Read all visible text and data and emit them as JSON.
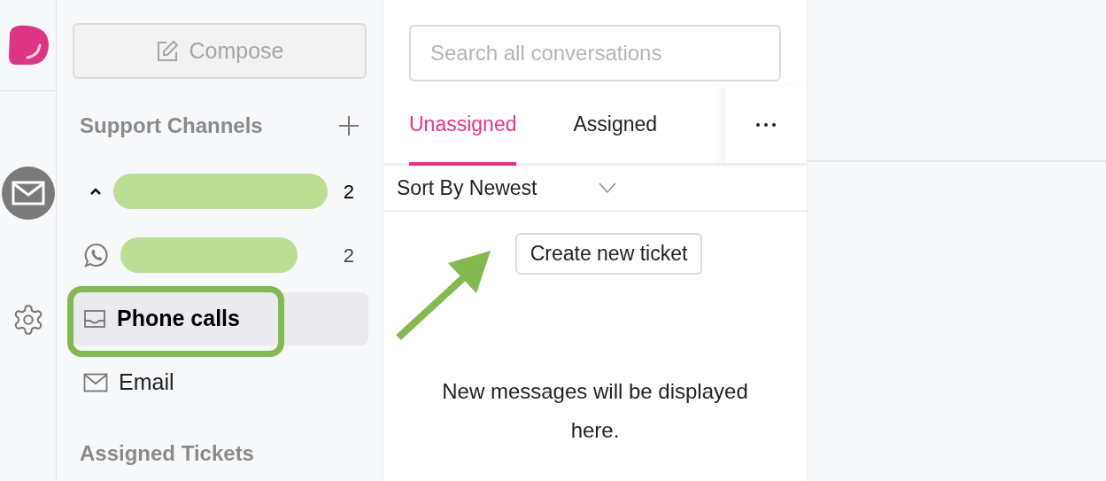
{
  "compose": {
    "label": "Compose",
    "disabled": true
  },
  "support_channels": {
    "title": "Support Channels",
    "items": [
      {
        "kind": "group",
        "count": "2",
        "selected": false
      },
      {
        "kind": "whatsapp",
        "count": "2",
        "selected": false
      },
      {
        "kind": "inbox",
        "label": "Phone calls",
        "selected": true
      },
      {
        "kind": "mail",
        "label": "Email",
        "selected": false
      }
    ]
  },
  "assigned_tickets": {
    "title": "Assigned Tickets"
  },
  "search": {
    "placeholder": "Search all conversations"
  },
  "tabs": [
    {
      "label": "Unassigned",
      "selected": true
    },
    {
      "label": "Assigned",
      "selected": false
    }
  ],
  "sort": {
    "label": "Sort By Newest"
  },
  "create_button": {
    "label": "Create new ticket"
  },
  "empty_message": "New messages will be displayed here."
}
